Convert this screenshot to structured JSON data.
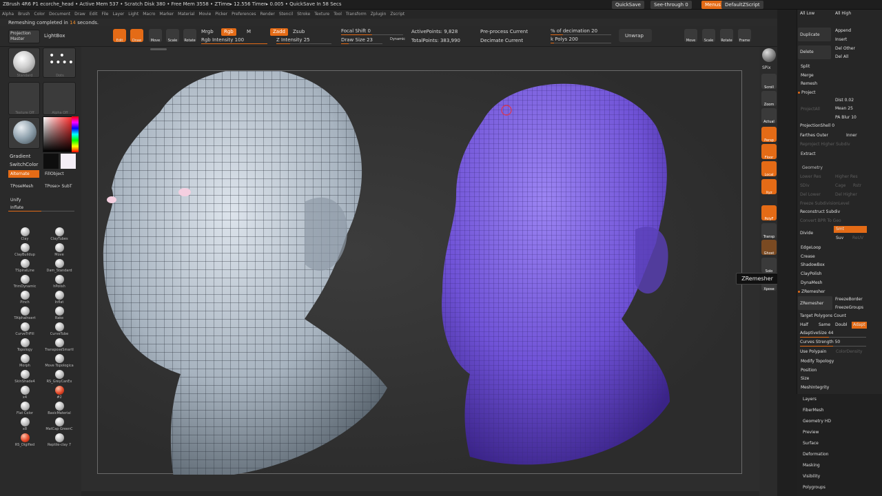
{
  "titlebar": {
    "title": "ZBrush 4R6 P1   ecorche_head   • Active Mem 537 • Scratch Disk 380 • Free Mem 3558 • ZTime▸ 12.556 Timer▸ 0.005 • QuickSave In 58 Secs",
    "quicksave": "QuickSave",
    "see_through": "See-through  0",
    "menus": "Menus",
    "script": "DefaultZScript"
  },
  "menubar": [
    "Alpha",
    "Brush",
    "Color",
    "Document",
    "Draw",
    "Edit",
    "File",
    "Layer",
    "Light",
    "Macro",
    "Marker",
    "Material",
    "Movie",
    "Picker",
    "Preferences",
    "Render",
    "Stencil",
    "Stroke",
    "Texture",
    "Tool",
    "Transform",
    "Zplugin",
    "Zscript"
  ],
  "notice": {
    "before": "Remeshing completed in ",
    "num": "14",
    "after": " seconds."
  },
  "topshelf": {
    "edit": "Edit",
    "draw": "Draw",
    "move": "Move",
    "scale": "Scale",
    "rotate": "Rotate",
    "mrgb": "Mrgb",
    "rgb": "Rgb",
    "m": "M",
    "rgb_intensity": "Rgb Intensity 100",
    "zadd": "Zadd",
    "zsub": "Zsub",
    "z_intensity": "Z Intensity 25",
    "focal_shift": "Focal Shift 0",
    "draw_size": "Draw Size 23",
    "dynamic": "Dynamic",
    "active_points": "ActivePoints: 9,828",
    "total_points": "TotalPoints: 383,990",
    "preprocess": "Pre-process Current",
    "decimate": "Decimate Current",
    "pct_decimation": "% of decimation 20",
    "k_polys": "k Polys 200",
    "unwrap": "Unwrap",
    "nav": [
      "Move",
      "Scale",
      "Rotate",
      "Frame"
    ]
  },
  "leftpanel": {
    "projection_master": "Projection Master",
    "lightbox": "LightBox",
    "brush1": "Standard",
    "brush2": "Dots",
    "texture": "Texture Off",
    "alpha": "Alpha Off",
    "gradient": "Gradient",
    "switch_color": "SwitchColor",
    "alternate": "Alternate",
    "fill_object": "FillObject",
    "tpose_mesh": "TPoseMesh",
    "tpose_subt": "TPose> SubT",
    "unify": "Unify",
    "inflate": "Inflate",
    "brushes": [
      [
        "Clay",
        "ClayTubes"
      ],
      [
        "ClayBuildup",
        "Move"
      ],
      [
        "TSpiralLine",
        "Dam_Standard"
      ],
      [
        "TrimDynamic",
        "hPolish"
      ],
      [
        "Pinch",
        "Inflat"
      ],
      [
        "TAlphaInsert",
        "Rake"
      ],
      [
        "CurveTriFill",
        "CurveTube"
      ],
      [
        "Topology",
        "TransposeSmartl"
      ],
      [
        "Morph",
        "Move Topologica"
      ],
      [
        "SkinShade4",
        "RS_GreyCanEx"
      ],
      [
        "x4",
        "#2"
      ],
      [
        "Flat Color",
        "BasicMaterial"
      ],
      [
        "x8",
        "MatCap GreenC"
      ],
      [
        "RS_Digified",
        "Reptile-clay 7"
      ]
    ]
  },
  "rightshelf": [
    "SPix",
    "Scroll",
    "Zoom",
    "Actual",
    "Persp",
    "Floor",
    "Local",
    "Xyz",
    "PolyF",
    "Transp",
    "Ghost",
    "Solo",
    "Xpose"
  ],
  "tooltip": "ZRemesher",
  "rightpanel": {
    "all_low": "All Low",
    "all_high": "All High",
    "duplicate": "Duplicate",
    "append": "Append",
    "insert": "Insert",
    "delete": "Delete",
    "del_other": "Del Other",
    "del_all": "Del All",
    "split": "Split",
    "merge": "Merge",
    "remesh": "Remesh",
    "project": "Project",
    "project_all": "ProjectAll",
    "dist": "Dist 0.02",
    "mean": "Mean 25",
    "pa_blur": "PA Blur 10",
    "projection_shell": "ProjectionShell 0",
    "farthest_outer": "Farthes Outer",
    "inner": "Inner",
    "reproject": "Reproject Higher Subdiv",
    "extract": "Extract",
    "geometry": "Geometry",
    "lower_res": "Lower Res",
    "higher_res": "Higher Res",
    "sdiv": "SDiv",
    "cage": "Cage",
    "rstr": "Rstr",
    "del_lower": "Del Lower",
    "del_higher": "Del Higher",
    "freeze_subdiv": "Freeze SubdivisionLevel",
    "reconstruct": "Reconstruct Subdiv",
    "convert_bpr": "Convert BPR To Geo",
    "divide": "Divide",
    "smt": "Smt",
    "suv": "Suv",
    "reuv": "ReUV",
    "edgeloop": "EdgeLoop",
    "crease": "Crease",
    "shadowbox": "ShadowBox",
    "claypolish": "ClayPolish",
    "dynamesh": "DynaMesh",
    "zremesher_hd": "ZRemesher",
    "zremesher_btn": "ZRemesher",
    "freeze_border": "FreezeBorder",
    "freeze_groups": "FreezeGroups",
    "target_polys": "Target Polygons Count",
    "half": "Half",
    "same": "Same",
    "double": "Doubl",
    "adapt": "Adapt",
    "adaptive_size": "AdaptiveSize 44",
    "curves_strength": "Curves Strength 50",
    "use_polypaint": "Use Polypain",
    "color_density": "ColorDensity",
    "modify_topology": "Modify Topology",
    "position": "Position",
    "size": "Size",
    "mesh_integrity": "MeshIntegrity",
    "subpalettes": [
      "Layers",
      "FiberMesh",
      "Geometry HD",
      "Preview",
      "Surface",
      "Deformation",
      "Masking",
      "Visibility",
      "Polygroups"
    ]
  },
  "colors": {
    "accent": "#e46b16",
    "panel": "#2a2a2a",
    "head_left": "#b4bec8",
    "head_right": "#7e62e0"
  }
}
